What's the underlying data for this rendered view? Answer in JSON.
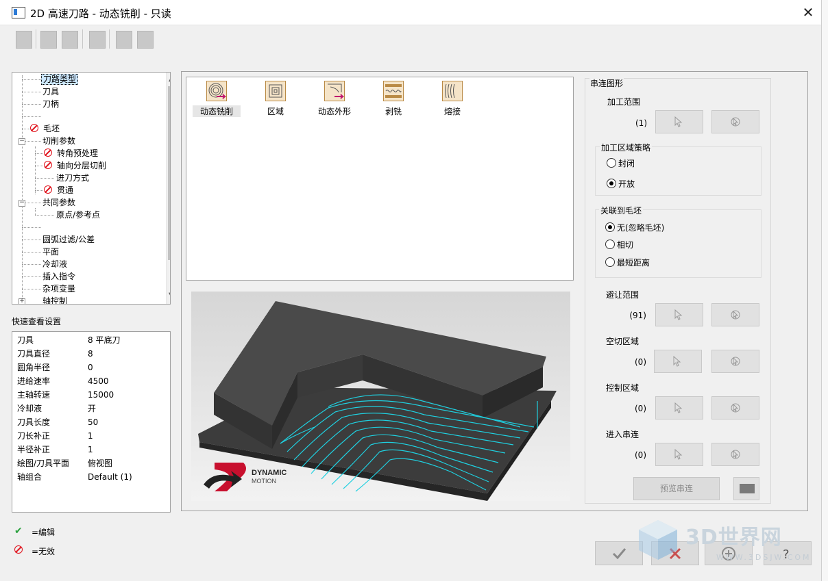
{
  "window": {
    "title": "2D 高速刀路 - 动态铣削 - 只读",
    "close_glyph": "✕"
  },
  "toolbar": {
    "buttons": [
      "tool-icon",
      "save-icon",
      "save-as-icon",
      "calculator-icon",
      "find-icon",
      "export-icon"
    ]
  },
  "tree": {
    "items": [
      {
        "label": "刀路类型",
        "state": "selected"
      },
      {
        "label": "刀具"
      },
      {
        "label": "刀柄"
      },
      {
        "label": ""
      },
      {
        "label": "毛坯",
        "state": "invalid"
      },
      {
        "label": "切削参数"
      },
      {
        "label": "转角预处理",
        "state": "invalid"
      },
      {
        "label": "轴向分层切削",
        "state": "invalid"
      },
      {
        "label": "进刀方式"
      },
      {
        "label": "贯通",
        "state": "invalid"
      },
      {
        "label": "共同参数"
      },
      {
        "label": "原点/参考点"
      },
      {
        "label": ""
      },
      {
        "label": "圆弧过滤/公差"
      },
      {
        "label": "平面"
      },
      {
        "label": "冷却液"
      },
      {
        "label": "插入指令"
      },
      {
        "label": "杂项变量"
      },
      {
        "label": "轴控制"
      }
    ]
  },
  "quick_view": {
    "title": "快速查看设置",
    "rows": [
      {
        "k": "刀具",
        "v": "8 平底刀"
      },
      {
        "k": "刀具直径",
        "v": "8"
      },
      {
        "k": "圆角半径",
        "v": "0"
      },
      {
        "k": "进给速率",
        "v": "4500"
      },
      {
        "k": "主轴转速",
        "v": "15000"
      },
      {
        "k": "冷却液",
        "v": "开"
      },
      {
        "k": "刀具长度",
        "v": "50"
      },
      {
        "k": "刀长补正",
        "v": "1"
      },
      {
        "k": "半径补正",
        "v": "1"
      },
      {
        "k": "绘图/刀具平面",
        "v": "俯视图"
      },
      {
        "k": "轴组合",
        "v": "Default (1)"
      }
    ]
  },
  "legend": {
    "edit": "=编辑",
    "invalid": "=无效"
  },
  "path_types": [
    {
      "label": "动态铣削",
      "selected": true
    },
    {
      "label": "区域"
    },
    {
      "label": "动态外形"
    },
    {
      "label": "剥铣"
    },
    {
      "label": "熔接"
    }
  ],
  "preview": {
    "logo_line1": "DYNAMIC",
    "logo_line2": "MOTION"
  },
  "chain": {
    "title": "串连图形",
    "machining_range": {
      "label": "加工范围",
      "count": "(1)"
    },
    "strategy": {
      "title": "加工区域策略",
      "options": [
        {
          "label": "封闭",
          "checked": false
        },
        {
          "label": "开放",
          "checked": true
        }
      ]
    },
    "stock_assoc": {
      "title": "关联到毛坯",
      "options": [
        {
          "label": "无(忽略毛坯)",
          "checked": true
        },
        {
          "label": "相切",
          "checked": false
        },
        {
          "label": "最短距离",
          "checked": false
        }
      ]
    },
    "avoid": {
      "label": "避让范围",
      "count": "(91)"
    },
    "air": {
      "label": "空切区域",
      "count": "(0)"
    },
    "control": {
      "label": "控制区域",
      "count": "(0)"
    },
    "entry": {
      "label": "进入串连",
      "count": "(0)"
    },
    "preview_button": "预览串连",
    "swatch_color": "#7a7a7a"
  },
  "footer": {
    "watermark_title": "3D世界网",
    "watermark_url": "WWW.3DSJW.COM"
  },
  "colors": {
    "toolpath": "#1fd0e0",
    "invalid": "#e0101a",
    "edit": "#28a03c"
  }
}
